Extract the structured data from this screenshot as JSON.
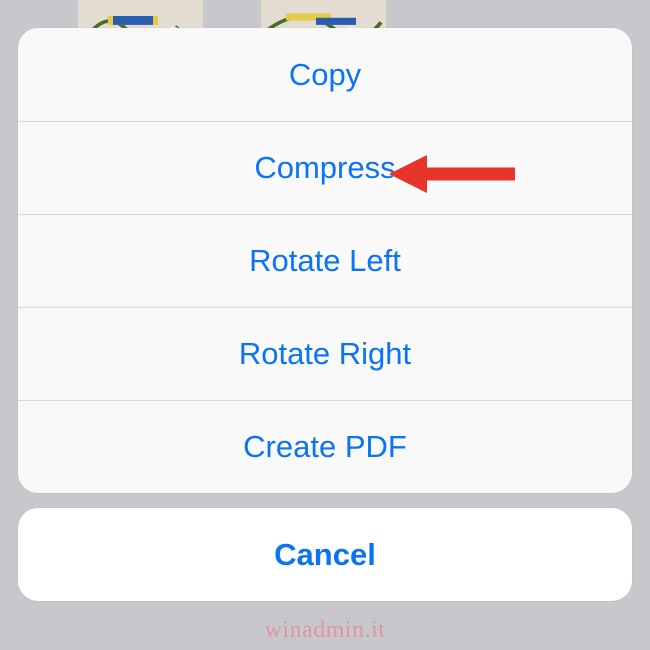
{
  "action_sheet": {
    "items": [
      {
        "label": "Copy"
      },
      {
        "label": "Compress"
      },
      {
        "label": "Rotate Left"
      },
      {
        "label": "Rotate Right"
      },
      {
        "label": "Create PDF"
      }
    ],
    "cancel_label": "Cancel"
  },
  "annotation": {
    "arrow_color": "#e7352c",
    "target_index": 1
  },
  "watermark": "winadmin.it"
}
